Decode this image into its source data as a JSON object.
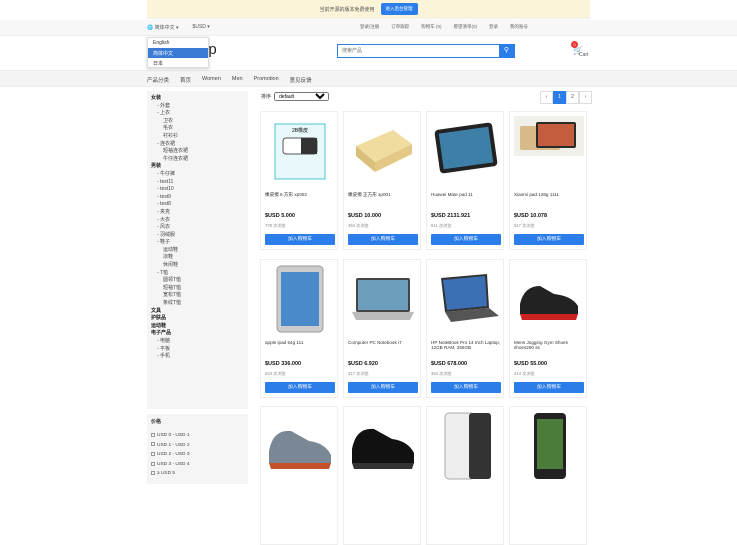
{
  "banner": {
    "text": "当前开源的版本免费使用",
    "button": "进入后台管理"
  },
  "topbar": {
    "lang": "简体中文",
    "currency": "$USD",
    "links": [
      "登录/注册",
      "订单跟踪",
      "购物车 (0)",
      "愿望清单(0)",
      "登录",
      "我的账号"
    ]
  },
  "lang_menu": [
    "English",
    "简体中文",
    "日本"
  ],
  "logo": "op",
  "search": {
    "placeholder": "搜索产品"
  },
  "cart": {
    "count": "0",
    "label": "Cart"
  },
  "nav": [
    "产品分类",
    "首页",
    "Women",
    "Men",
    "Promotion",
    "意见反馈"
  ],
  "categories": [
    {
      "t": "女装",
      "b": true
    },
    {
      "t": "- 外套"
    },
    {
      "t": "- 上衣"
    },
    {
      "t": "卫衣",
      "i": 2
    },
    {
      "t": "毛衣",
      "i": 2
    },
    {
      "t": "衬衫衫",
      "i": 2
    },
    {
      "t": "- 连衣裙"
    },
    {
      "t": "短袖连衣裙",
      "i": 2
    },
    {
      "t": "牛仔连衣裙",
      "i": 2
    },
    {
      "t": "男装",
      "b": true
    },
    {
      "t": "- 牛仔裤"
    },
    {
      "t": "- test11"
    },
    {
      "t": "- test10"
    },
    {
      "t": "- test9"
    },
    {
      "t": "- test8"
    },
    {
      "t": "- 夹克"
    },
    {
      "t": "- 大衣"
    },
    {
      "t": "- 风衣"
    },
    {
      "t": "- 羽绒服"
    },
    {
      "t": "- 鞋子"
    },
    {
      "t": "运动鞋",
      "i": 2
    },
    {
      "t": "凉鞋",
      "i": 2
    },
    {
      "t": "休闲鞋",
      "i": 2
    },
    {
      "t": "- T恤"
    },
    {
      "t": "圆领T恤",
      "i": 2
    },
    {
      "t": "短袖T恤",
      "i": 2
    },
    {
      "t": "宽松T恤",
      "i": 2
    },
    {
      "t": "条纹T恤",
      "i": 2
    },
    {
      "t": "文具",
      "b": true
    },
    {
      "t": "护肤品",
      "b": true
    },
    {
      "t": "运动鞋",
      "b": true
    },
    {
      "t": "电子产品",
      "b": true
    },
    {
      "t": "- 电脑"
    },
    {
      "t": "- 平板"
    },
    {
      "t": "- 手机"
    }
  ],
  "price_filter": {
    "title": "价格",
    "ranges": [
      "USD 0 - USD 1",
      "USD 1 - USD 2",
      "USD 2 - USD 3",
      "USD 3 - USD 4",
      "≥ USD 5"
    ]
  },
  "sort": {
    "label": "排序",
    "value": "default"
  },
  "pager": [
    "‹",
    "1",
    "2",
    "›"
  ],
  "products": [
    {
      "name": "橡皮擦 8.方形 xp002",
      "price": "$USD 5.000",
      "sold": "778 次浏览",
      "btn": "加入购物车",
      "icon": "eraser-icon"
    },
    {
      "name": "橡皮擦 正方形 xp001",
      "price": "$USD 10.000",
      "sold": "464 次浏览",
      "btn": "加入购物车",
      "icon": "eraser-block-icon"
    },
    {
      "name": "Huawei Mate pad 11",
      "price": "$USD 2131.921",
      "sold": "611 次浏览",
      "btn": "加入购物车",
      "icon": "tablet-icon"
    },
    {
      "name": "Xiaomi pad 128g 1111",
      "price": "$USD 10.078",
      "sold": "517 次浏览",
      "btn": "加入购物车",
      "icon": "tablet-gold-icon"
    },
    {
      "name": "apple ipad 64g 111",
      "price": "$USD 336.000",
      "sold": "523 次浏览",
      "btn": "加入购物车",
      "icon": "ipad-icon"
    },
    {
      "name": "Computer PC Notebook i7",
      "price": "$USD 6.920",
      "sold": "417 次浏览",
      "btn": "加入购物车",
      "icon": "laptop-icon"
    },
    {
      "name": "HP NoteBook Pro 14 Inch Laptop, 12GB RAM, 256GB",
      "price": "$USD 678.000",
      "sold": "384 次浏览",
      "btn": "加入购物车",
      "icon": "laptop-dark-icon"
    },
    {
      "name": "Mens Jogging Gym Shoes shoes260 ss",
      "price": "$USD 55.000",
      "sold": "414 次浏览",
      "btn": "加入购物车",
      "icon": "shoe-icon"
    },
    {
      "name": "",
      "price": "",
      "sold": "",
      "btn": "",
      "icon": "sneaker-icon"
    },
    {
      "name": "",
      "price": "",
      "sold": "",
      "btn": "",
      "icon": "sneaker-black-icon"
    },
    {
      "name": "",
      "price": "",
      "sold": "",
      "btn": "",
      "icon": "phone-white-icon"
    },
    {
      "name": "",
      "price": "",
      "sold": "",
      "btn": "",
      "icon": "phone-black-icon"
    }
  ]
}
